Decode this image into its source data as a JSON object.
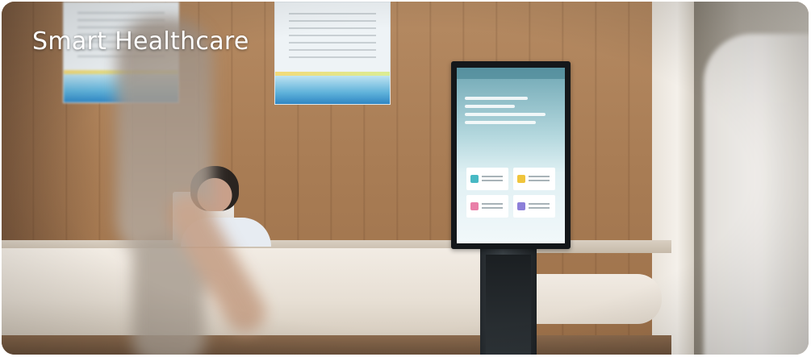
{
  "banner": {
    "title": "Smart Healthcare"
  }
}
